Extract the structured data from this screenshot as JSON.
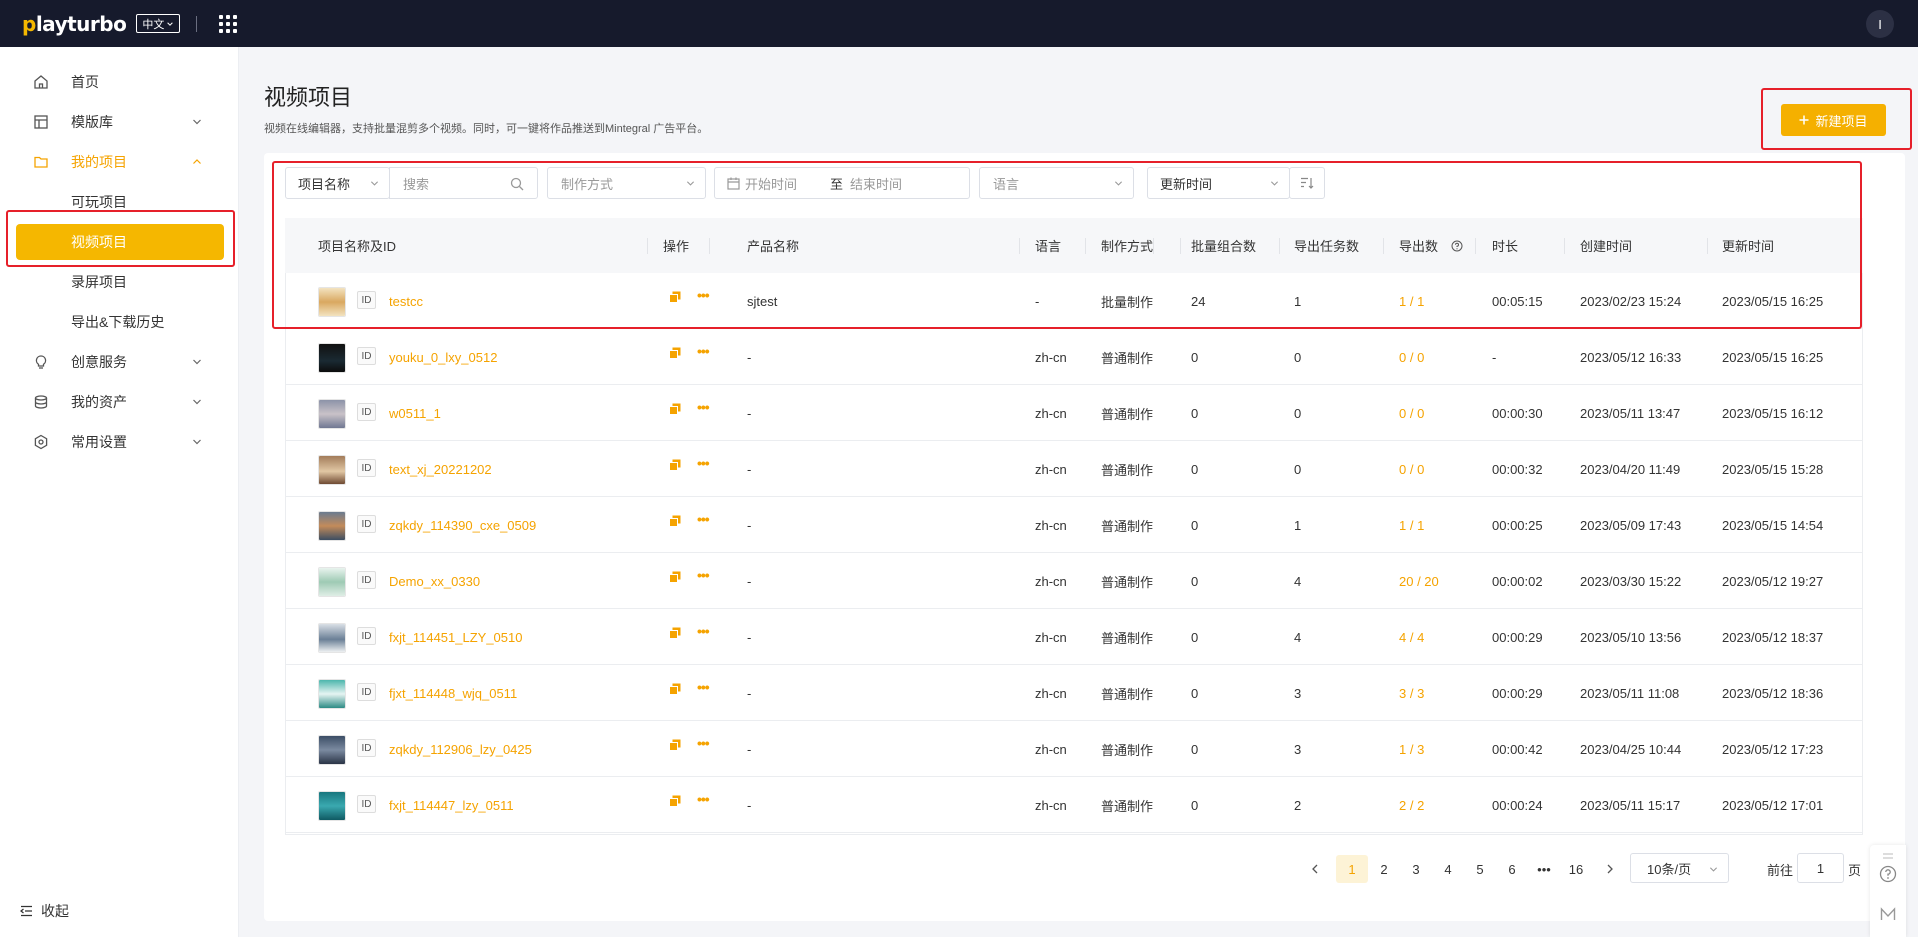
{
  "brand": {
    "logo": "playturbo",
    "language": "中文"
  },
  "user": {
    "initial": "I"
  },
  "sidebar": {
    "items": [
      {
        "label": "首页"
      },
      {
        "label": "模版库"
      },
      {
        "label": "我的项目"
      },
      {
        "label": "创意服务"
      },
      {
        "label": "我的资产"
      },
      {
        "label": "常用设置"
      }
    ],
    "sub_items": [
      {
        "label": "可玩项目"
      },
      {
        "label": "视频项目"
      },
      {
        "label": "录屏项目"
      },
      {
        "label": "导出&下载历史"
      }
    ],
    "collapse_label": "收起"
  },
  "page": {
    "title": "视频项目",
    "description": "视频在线编辑器，支持批量混剪多个视频。同时，可一键将作品推送到Mintegral 广告平台。",
    "new_button": "新建项目"
  },
  "filters": {
    "field_select": "项目名称",
    "search_placeholder": "搜索",
    "method_placeholder": "制作方式",
    "start_placeholder": "开始时间",
    "range_sep": "至",
    "end_placeholder": "结束时间",
    "language_placeholder": "语言",
    "sort_select": "更新时间"
  },
  "table": {
    "columns": [
      "项目名称及ID",
      "操作",
      "产品名称",
      "语言",
      "制作方式",
      "批量组合数",
      "导出任务数",
      "导出数",
      "时长",
      "创建时间",
      "更新时间"
    ],
    "id_tag": "ID",
    "rows": [
      {
        "name": "testcc",
        "product": "sjtest",
        "lang": "-",
        "method": "批量制作",
        "combos": "24",
        "tasks": "1",
        "exports": "1 / 1",
        "duration": "00:05:15",
        "created": "2023/02/23 15:24",
        "updated": "2023/05/15 16:25"
      },
      {
        "name": "youku_0_lxy_0512",
        "product": "-",
        "lang": "zh-cn",
        "method": "普通制作",
        "combos": "0",
        "tasks": "0",
        "exports": "0 / 0",
        "duration": "-",
        "created": "2023/05/12 16:33",
        "updated": "2023/05/15 16:25"
      },
      {
        "name": "w0511_1",
        "product": "-",
        "lang": "zh-cn",
        "method": "普通制作",
        "combos": "0",
        "tasks": "0",
        "exports": "0 / 0",
        "duration": "00:00:30",
        "created": "2023/05/11 13:47",
        "updated": "2023/05/15 16:12"
      },
      {
        "name": "text_xj_20221202",
        "product": "-",
        "lang": "zh-cn",
        "method": "普通制作",
        "combos": "0",
        "tasks": "0",
        "exports": "0 / 0",
        "duration": "00:00:32",
        "created": "2023/04/20 11:49",
        "updated": "2023/05/15 15:28"
      },
      {
        "name": "zqkdy_114390_cxe_0509",
        "product": "-",
        "lang": "zh-cn",
        "method": "普通制作",
        "combos": "0",
        "tasks": "1",
        "exports": "1 / 1",
        "duration": "00:00:25",
        "created": "2023/05/09 17:43",
        "updated": "2023/05/15 14:54"
      },
      {
        "name": "Demo_xx_0330",
        "product": "-",
        "lang": "zh-cn",
        "method": "普通制作",
        "combos": "0",
        "tasks": "4",
        "exports": "20 / 20",
        "duration": "00:00:02",
        "created": "2023/03/30 15:22",
        "updated": "2023/05/12 19:27"
      },
      {
        "name": "fxjt_114451_LZY_0510",
        "product": "-",
        "lang": "zh-cn",
        "method": "普通制作",
        "combos": "0",
        "tasks": "4",
        "exports": "4 / 4",
        "duration": "00:00:29",
        "created": "2023/05/10 13:56",
        "updated": "2023/05/12 18:37"
      },
      {
        "name": "fjxt_114448_wjq_0511",
        "product": "-",
        "lang": "zh-cn",
        "method": "普通制作",
        "combos": "0",
        "tasks": "3",
        "exports": "3 / 3",
        "duration": "00:00:29",
        "created": "2023/05/11 11:08",
        "updated": "2023/05/12 18:36"
      },
      {
        "name": "zqkdy_112906_lzy_0425",
        "product": "-",
        "lang": "zh-cn",
        "method": "普通制作",
        "combos": "0",
        "tasks": "3",
        "exports": "1 / 3",
        "duration": "00:00:42",
        "created": "2023/04/25 10:44",
        "updated": "2023/05/12 17:23"
      },
      {
        "name": "fxjt_114447_lzy_0511",
        "product": "-",
        "lang": "zh-cn",
        "method": "普通制作",
        "combos": "0",
        "tasks": "2",
        "exports": "2 / 2",
        "duration": "00:00:24",
        "created": "2023/05/11 15:17",
        "updated": "2023/05/12 17:01"
      }
    ]
  },
  "pagination": {
    "pages": [
      "1",
      "2",
      "3",
      "4",
      "5",
      "6",
      "16"
    ],
    "ellipsis": "•••",
    "current": "1",
    "page_size": "10条/页",
    "goto_label": "前往",
    "goto_value": "1",
    "page_unit": "页"
  },
  "colors": {
    "accent": "#f5b000",
    "topbar": "#161a2c",
    "highlight_box": "#e6202a"
  }
}
